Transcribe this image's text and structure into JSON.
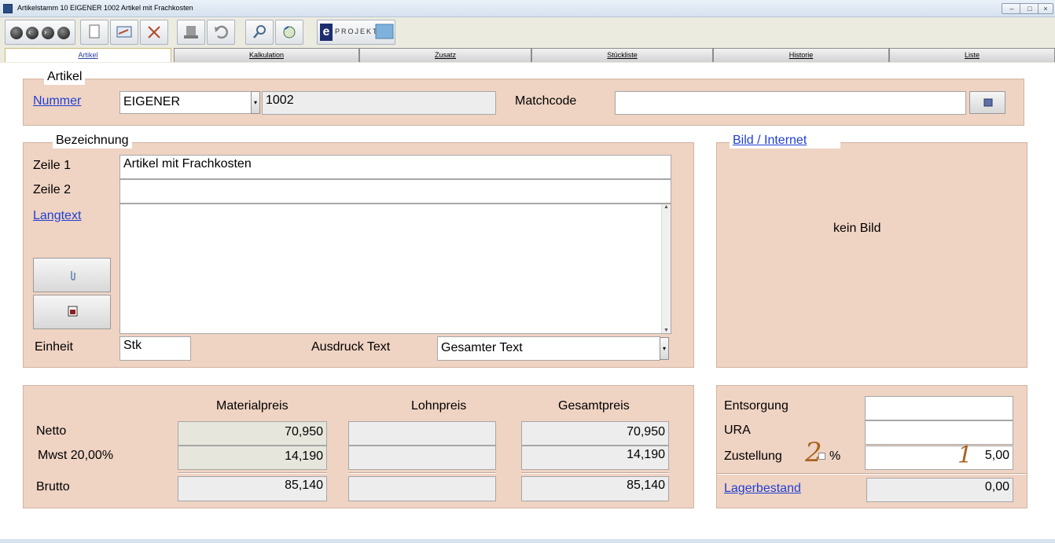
{
  "window": {
    "title": "Artikelstamm 10 EIGENER  1002  Artikel mit Frachkosten",
    "minimize": "–",
    "maximize": "□",
    "close": "×"
  },
  "toolbar": {
    "eprojekt_letter": "e",
    "eprojekt_label": "PROJEKT:"
  },
  "tabs": [
    "Artikel",
    "Kalkulation",
    "Zusatz",
    "Stückliste",
    "Historie",
    "Liste"
  ],
  "artikel": {
    "legend": "Artikel",
    "nummer_label": "Nummer",
    "nummer_prefix": "EIGENER",
    "nummer_value": "1002",
    "matchcode_label": "Matchcode",
    "matchcode_value": ""
  },
  "bezeichnung": {
    "legend": "Bezeichnung",
    "zeile1_label": "Zeile 1",
    "zeile1_value": "Artikel mit Frachkosten",
    "zeile2_label": "Zeile 2",
    "zeile2_value": "",
    "langtext_label": "Langtext",
    "langtext_value": "",
    "einheit_label": "Einheit",
    "einheit_value": "Stk",
    "ausdruck_label": "Ausdruck Text",
    "ausdruck_value": "Gesamter Text"
  },
  "bild": {
    "legend": "Bild / Internet",
    "placeholder": "kein Bild"
  },
  "preise": {
    "headers": {
      "material": "Materialpreis",
      "lohn": "Lohnpreis",
      "gesamt": "Gesamtpreis"
    },
    "rows": [
      {
        "label": "Netto",
        "material": "70,950",
        "lohn": "",
        "gesamt": "70,950"
      },
      {
        "label": "Mwst 20,00%",
        "material": "14,190",
        "lohn": "",
        "gesamt": "14,190"
      },
      {
        "label": "Brutto",
        "material": "85,140",
        "lohn": "",
        "gesamt": "85,140"
      }
    ]
  },
  "zusatzkosten": {
    "entsorgung_label": "Entsorgung",
    "entsorgung_value": "",
    "ura_label": "URA",
    "ura_value": "",
    "zustellung_label": "Zustellung",
    "zustellung_unit": "%",
    "zustellung_value": "5,00",
    "lagerbestand_label": "Lagerbestand",
    "lagerbestand_value": "0,00"
  },
  "annotations": {
    "mark1": "1",
    "mark2": "2"
  }
}
